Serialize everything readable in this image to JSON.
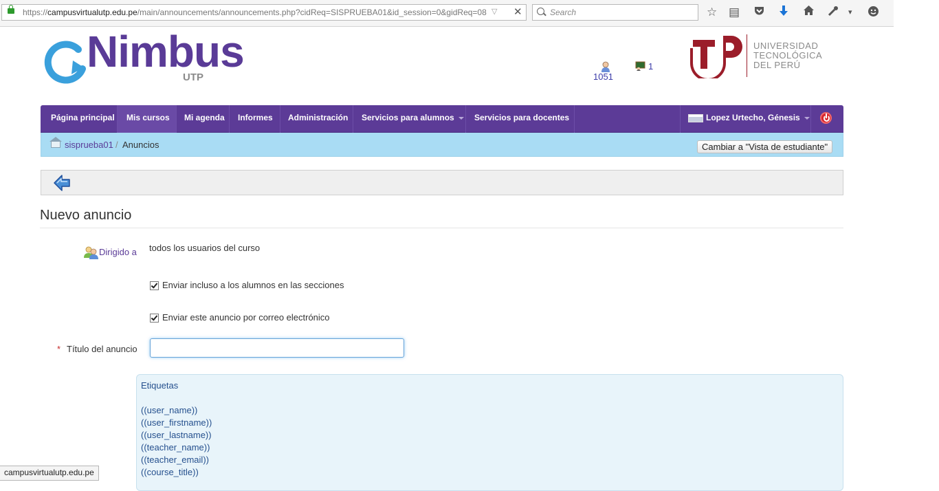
{
  "browser": {
    "url_prefix": "https://",
    "url_domain": "campusvirtualutp.edu.pe",
    "url_rest": "/main/announcements/announcements.php?cidReq=SISPRUEBA01&id_session=0&gidReq=08",
    "search_placeholder": "Search",
    "status_text": "campusvirtualutp.edu.pe"
  },
  "header": {
    "logo_main": "Nimbus",
    "logo_sub": "UTP",
    "users_online": "1051",
    "teachers_online": "1",
    "university_lines": [
      "UNIVERSIDAD",
      "TECNOLÓGICA",
      "DEL PERÚ"
    ]
  },
  "nav": {
    "items": [
      {
        "label": "Página principal"
      },
      {
        "label": "Mis cursos"
      },
      {
        "label": "Mi agenda"
      },
      {
        "label": "Informes"
      },
      {
        "label": "Administración"
      },
      {
        "label": "Servicios para alumnos"
      },
      {
        "label": "Servicios para docentes"
      }
    ],
    "user_name": "Lopez Urtecho, Génesis"
  },
  "breadcrumb": {
    "course": "sisprueba01",
    "separator": "/",
    "current": "Anuncios",
    "student_view_button": "Cambiar a \"Vista de estudiante\""
  },
  "form": {
    "page_title": "Nuevo anuncio",
    "recipients_label": "Dirigido a",
    "recipients_value": "todos los usuarios del curso",
    "checkbox_sections": "Enviar incluso a los alumnos en las secciones",
    "checkbox_email": "Enviar este anuncio por correo electrónico",
    "required_mark": "*",
    "title_label": "Título del anuncio",
    "title_value": ""
  },
  "tags": {
    "title": "Etiquetas",
    "items": [
      "((user_name))",
      "((user_firstname))",
      "((user_lastname))",
      "((teacher_name))",
      "((teacher_email))",
      "((course_title))"
    ]
  },
  "colors": {
    "nav_bg": "#5c3b97",
    "breadcrumb_bg": "#a9dcf4",
    "tags_bg": "#e8f4fa",
    "utp_red": "#9b1d2a"
  }
}
